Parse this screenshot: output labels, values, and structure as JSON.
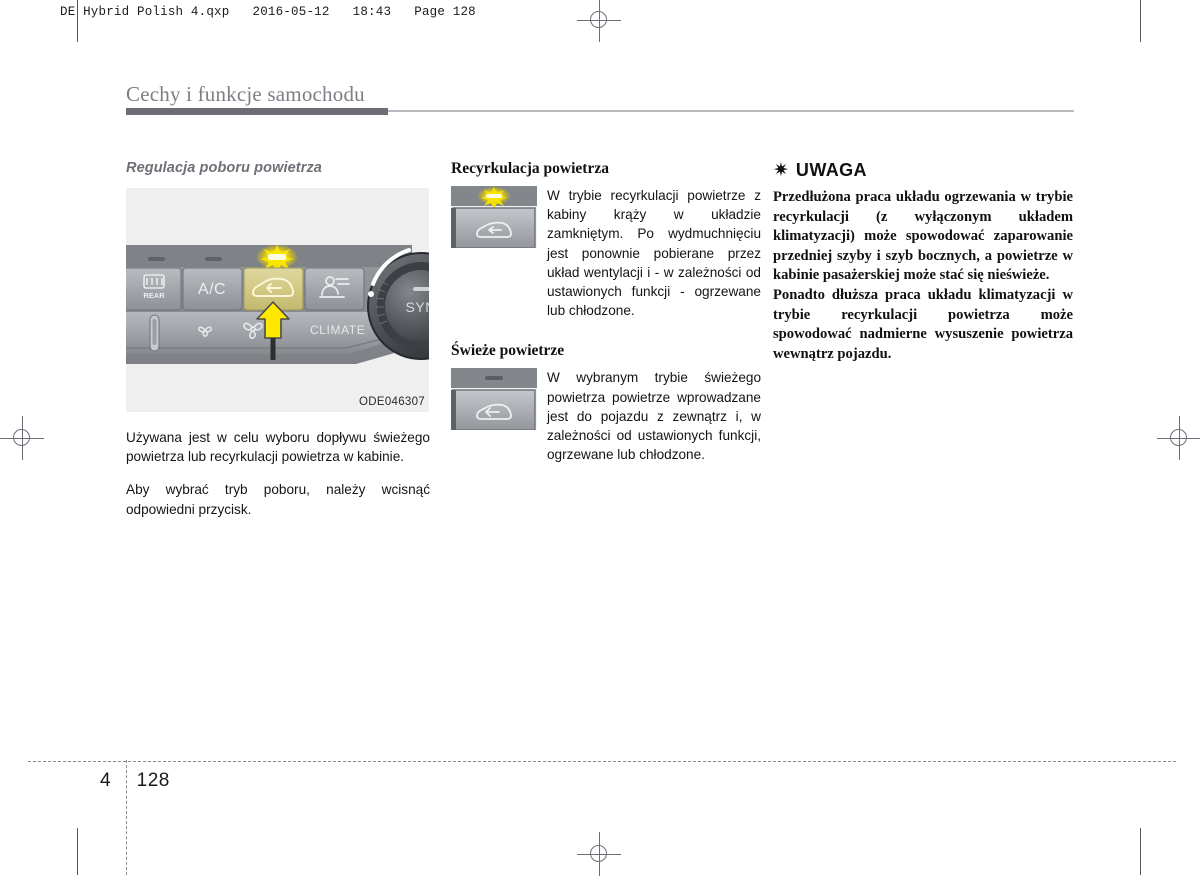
{
  "page": {
    "file_header": "DE Hybrid Polish 4.qxp   2016-05-12   18:43   Page 128",
    "chapter_title": "Cechy i funkcje samochodu",
    "footer_chapter": "4",
    "footer_page": "128"
  },
  "column_left": {
    "heading": "Regulacja poboru powietrza",
    "figure_caption": "ODE046307",
    "figure_labels": {
      "rear": "REAR",
      "ac": "A/C",
      "climate": "CLIMATE",
      "sync": "SYNC"
    },
    "paragraph_1": "Używana jest w celu wyboru dopływu świeżego powietrza lub recyrkulacji powietrza w kabinie.",
    "paragraph_2": "Aby wybrać tryb poboru, należy wcisnąć odpowiedni przycisk."
  },
  "column_middle": {
    "section_1": {
      "heading": "Recyrkulacja powietrza",
      "text": "W trybie recyrkulacji powietrze z kabiny krąży w układzie zamkniętym. Po wydmuchnięciu jest ponownie pobierane przez układ wentylacji i - w zależności od ustawionych funkcji - ogrzewane lub chłodzone."
    },
    "section_2": {
      "heading": "Świeże powietrze",
      "text": "W wybranym trybie świeżego powietrza powietrze wprowadzane jest do pojazdu z zewnątrz i, w zależności od ustawionych funkcji, ogrzewane lub chłodzone."
    }
  },
  "column_right": {
    "notice_icon": "asterisk-icon",
    "notice_title": "UWAGA",
    "notice_paragraph_1": "Przedłużona praca układu ogrzewania w trybie recyrkulacji (z wyłączonym układem klimatyzacji) może spowodować zaparowanie przedniej szyby i szyb bocznych, a powietrze w kabinie pasażerskiej może stać się nieświeże.",
    "notice_paragraph_2": "Ponadto dłuższa praca układu klimatyzacji w trybie recyrkulacji powietrza może spowodować nadmierne wysuszenie powietrza wewnątrz pojazdu."
  },
  "colors": {
    "highlight_yellow": "#d9cf77",
    "indicator_yellow": "#f5e400",
    "arrow_yellow": "#ffe800",
    "panel_gray": "#8d9095",
    "title_gray": "#7d7d85"
  }
}
